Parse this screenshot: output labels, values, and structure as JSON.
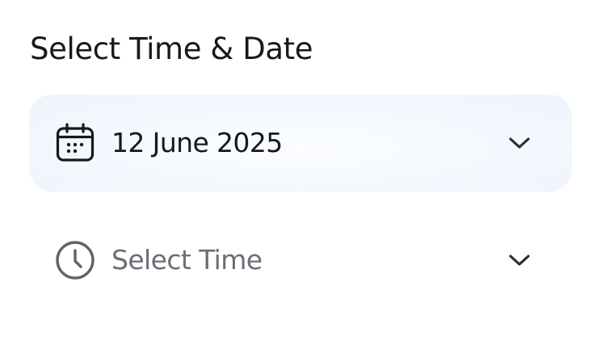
{
  "section": {
    "title": "Select Time & Date"
  },
  "date_select": {
    "value": "12 June 2025",
    "icon": "calendar-icon",
    "chevron_icon": "chevron-down-icon"
  },
  "time_select": {
    "placeholder": "Select Time",
    "icon": "clock-icon",
    "chevron_icon": "chevron-down-icon"
  },
  "colors": {
    "text_primary": "#16181d",
    "text_muted": "#6b6e75",
    "date_row_background": "#f2f7fd",
    "page_background": "#ffffff"
  }
}
